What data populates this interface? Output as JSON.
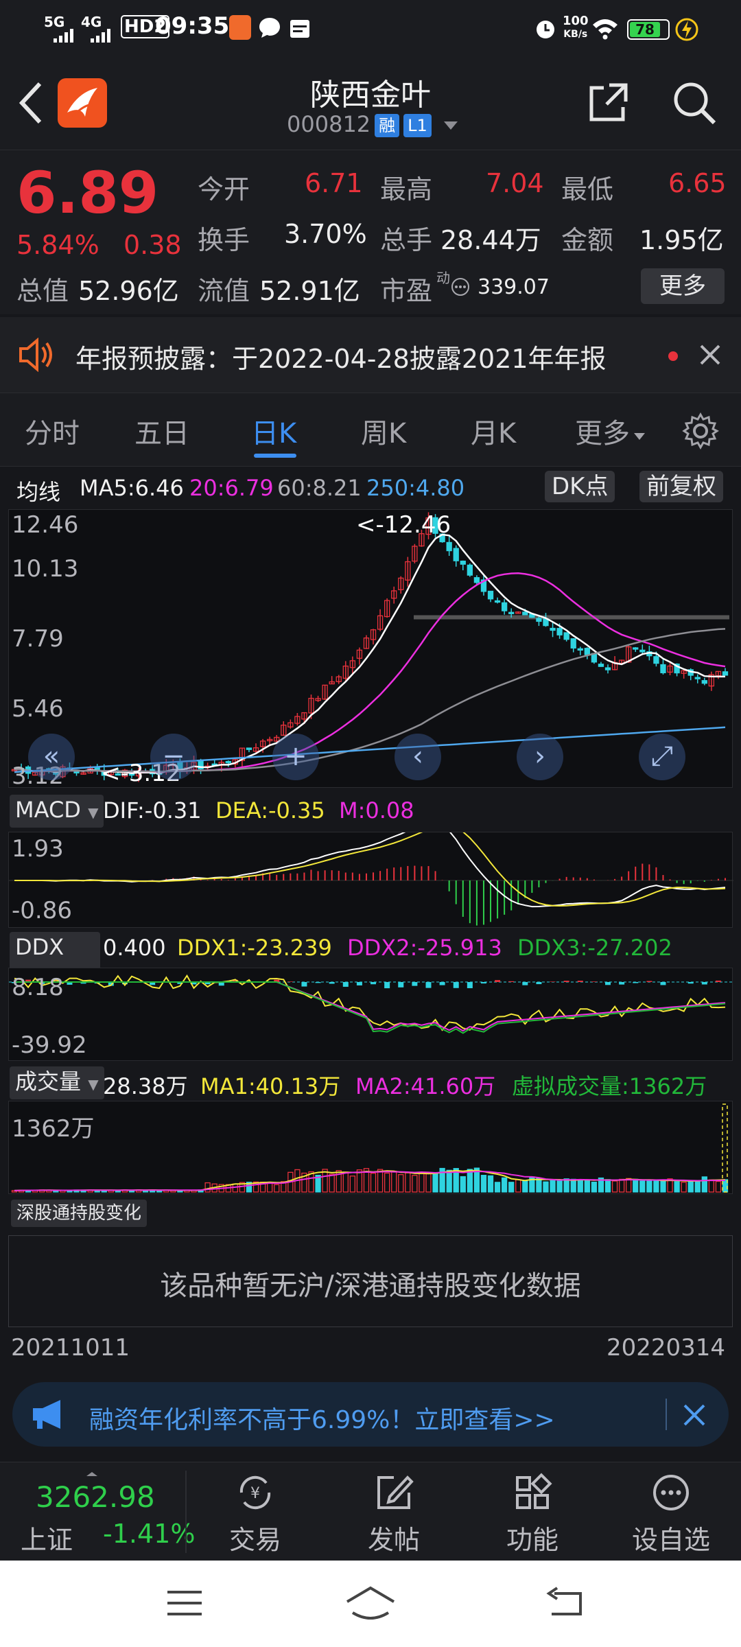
{
  "status_bar": {
    "signal1": "5G",
    "signal2": "4G",
    "hd": "HD2",
    "time": "09:35",
    "net_speed_value": "100",
    "net_speed_unit": "KB/s",
    "battery": "78"
  },
  "header": {
    "title": "陕西金叶",
    "code": "000812",
    "badge1": "融",
    "badge2": "L1"
  },
  "quote": {
    "price": "6.89",
    "change_pct": "5.84%",
    "change": "0.38",
    "open_label": "今开",
    "open": "6.71",
    "high_label": "最高",
    "high": "7.04",
    "low_label": "最低",
    "low": "6.65",
    "turnover_label": "换手",
    "turnover": "3.70%",
    "volume_label": "总手",
    "volume": "28.44万",
    "amount_label": "金额",
    "amount": "1.95亿",
    "mktcap_label": "总值",
    "mktcap": "52.96亿",
    "float_label": "流值",
    "float": "52.91亿",
    "pe_label": "市盈",
    "pe_sup": "动",
    "pe": "339.07",
    "more": "更多"
  },
  "notice": {
    "text": "年报预披露：于2022-04-28披露2021年年报"
  },
  "tabs": [
    "分时",
    "五日",
    "日K",
    "周K",
    "月K",
    "更多"
  ],
  "kline": {
    "ma_label": "均线",
    "ma5": "MA5:6.46",
    "ma20": "20:6.79",
    "ma60": "60:8.21",
    "ma250": "250:4.80",
    "dk_button": "DK点",
    "adjust_button": "前复权",
    "y_ticks": [
      "12.46",
      "10.13",
      "7.79",
      "5.46",
      "3.12"
    ],
    "max_annotation": "<-12.46",
    "min_annotation": "<-3.12"
  },
  "macd": {
    "name": "MACD",
    "dif": "DIF:-0.31",
    "dea": "DEA:-0.35",
    "m": "M:0.08",
    "y_ticks": [
      "1.93",
      "-0.86"
    ]
  },
  "ddx": {
    "name": "DDX",
    "value": "0.400",
    "ddx1": "DDX1:-23.239",
    "ddx2": "DDX2:-25.913",
    "ddx3": "DDX3:-27.202",
    "y_ticks": [
      "8.18",
      "-39.92"
    ]
  },
  "volume": {
    "name": "成交量",
    "value": "28.38万",
    "ma1": "MA1:40.13万",
    "ma2": "MA2:41.60万",
    "virtual": "虚拟成交量:1362万",
    "y_tick": "1362万"
  },
  "hk_connect": {
    "label": "深股通持股变化",
    "empty": "该品种暂无沪/深港通持股变化数据"
  },
  "dates": {
    "start": "20211011",
    "end": "20220314"
  },
  "banner": {
    "text": "融资年化利率不高于6.99%！立即查看>>"
  },
  "bottom_nav": {
    "index_value": "3262.98",
    "index_name": "上证",
    "index_change": "-1.41%",
    "trade": "交易",
    "post": "发帖",
    "function": "功能",
    "watchlist": "设自选"
  },
  "colors": {
    "up": "#e8323c",
    "down": "#2fcf4b",
    "accent": "#3d8ef0"
  }
}
